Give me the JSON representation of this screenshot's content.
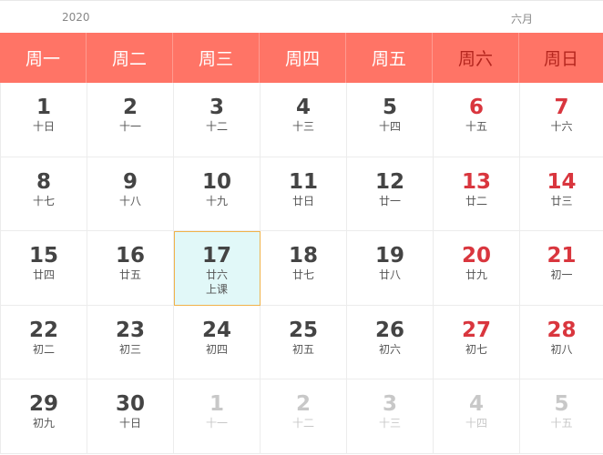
{
  "header": {
    "year": "2020",
    "month": "六月"
  },
  "weekdays": [
    {
      "label": "周一",
      "weekend": false
    },
    {
      "label": "周二",
      "weekend": false
    },
    {
      "label": "周三",
      "weekend": false
    },
    {
      "label": "周四",
      "weekend": false
    },
    {
      "label": "周五",
      "weekend": false
    },
    {
      "label": "周六",
      "weekend": true
    },
    {
      "label": "周日",
      "weekend": true
    }
  ],
  "days": [
    {
      "day": "1",
      "lunar": "十日"
    },
    {
      "day": "2",
      "lunar": "十一"
    },
    {
      "day": "3",
      "lunar": "十二"
    },
    {
      "day": "4",
      "lunar": "十三"
    },
    {
      "day": "5",
      "lunar": "十四"
    },
    {
      "day": "6",
      "lunar": "十五",
      "weekend": true
    },
    {
      "day": "7",
      "lunar": "十六",
      "weekend": true
    },
    {
      "day": "8",
      "lunar": "十七"
    },
    {
      "day": "9",
      "lunar": "十八"
    },
    {
      "day": "10",
      "lunar": "十九"
    },
    {
      "day": "11",
      "lunar": "廿日"
    },
    {
      "day": "12",
      "lunar": "廿一"
    },
    {
      "day": "13",
      "lunar": "廿二",
      "weekend": true
    },
    {
      "day": "14",
      "lunar": "廿三",
      "weekend": true
    },
    {
      "day": "15",
      "lunar": "廿四"
    },
    {
      "day": "16",
      "lunar": "廿五"
    },
    {
      "day": "17",
      "lunar": "廿六",
      "note": "上课",
      "today": true
    },
    {
      "day": "18",
      "lunar": "廿七"
    },
    {
      "day": "19",
      "lunar": "廿八"
    },
    {
      "day": "20",
      "lunar": "廿九",
      "weekend": true
    },
    {
      "day": "21",
      "lunar": "初一",
      "weekend": true
    },
    {
      "day": "22",
      "lunar": "初二"
    },
    {
      "day": "23",
      "lunar": "初三"
    },
    {
      "day": "24",
      "lunar": "初四"
    },
    {
      "day": "25",
      "lunar": "初五"
    },
    {
      "day": "26",
      "lunar": "初六"
    },
    {
      "day": "27",
      "lunar": "初七",
      "weekend": true
    },
    {
      "day": "28",
      "lunar": "初八",
      "weekend": true
    },
    {
      "day": "29",
      "lunar": "初九"
    },
    {
      "day": "30",
      "lunar": "十日"
    },
    {
      "day": "1",
      "lunar": "十一",
      "other": true
    },
    {
      "day": "2",
      "lunar": "十二",
      "other": true
    },
    {
      "day": "3",
      "lunar": "十三",
      "other": true
    },
    {
      "day": "4",
      "lunar": "十四",
      "other": true
    },
    {
      "day": "5",
      "lunar": "十五",
      "other": true
    }
  ],
  "colors": {
    "header_bg": "#ff7466",
    "weekend_text": "#d9363e",
    "today_bg": "#e1f8f8",
    "today_border": "#f0b24a",
    "muted": "#c8c8c8"
  }
}
